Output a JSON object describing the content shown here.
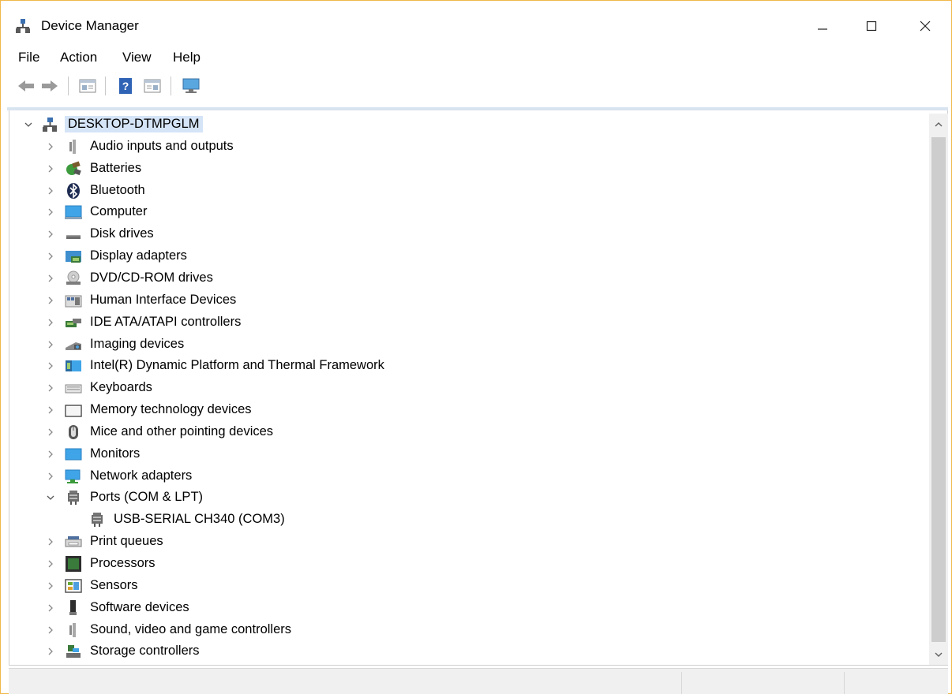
{
  "window": {
    "title": "Device Manager"
  },
  "menu": [
    "File",
    "Action",
    "View",
    "Help"
  ],
  "toolbar": [
    "back-icon",
    "forward-icon",
    "properties-icon",
    "help-icon",
    "update-driver-icon",
    "monitor-icon"
  ],
  "tree": {
    "root": "DESKTOP-DTMPGLM",
    "categories": [
      {
        "label": "Audio inputs and outputs",
        "icon": "speaker-icon"
      },
      {
        "label": "Batteries",
        "icon": "battery-icon"
      },
      {
        "label": "Bluetooth",
        "icon": "bluetooth-icon"
      },
      {
        "label": "Computer",
        "icon": "computer-icon"
      },
      {
        "label": "Disk drives",
        "icon": "disk-drive-icon"
      },
      {
        "label": "Display adapters",
        "icon": "display-adapter-icon"
      },
      {
        "label": "DVD/CD-ROM drives",
        "icon": "dvd-drive-icon"
      },
      {
        "label": "Human Interface Devices",
        "icon": "hid-icon"
      },
      {
        "label": "IDE ATA/ATAPI controllers",
        "icon": "ide-controller-icon"
      },
      {
        "label": "Imaging devices",
        "icon": "imaging-device-icon"
      },
      {
        "label": "Intel(R) Dynamic Platform and Thermal Framework",
        "icon": "intel-dptf-icon"
      },
      {
        "label": "Keyboards",
        "icon": "keyboard-icon"
      },
      {
        "label": "Memory technology devices",
        "icon": "memory-device-icon"
      },
      {
        "label": "Mice and other pointing devices",
        "icon": "mouse-icon"
      },
      {
        "label": "Monitors",
        "icon": "monitor-icon"
      },
      {
        "label": "Network adapters",
        "icon": "network-adapter-icon"
      },
      {
        "label": "Ports (COM & LPT)",
        "icon": "port-icon",
        "expanded": true,
        "children": [
          {
            "label": "USB-SERIAL CH340 (COM3)",
            "icon": "port-icon"
          }
        ]
      },
      {
        "label": "Print queues",
        "icon": "printer-icon"
      },
      {
        "label": "Processors",
        "icon": "processor-icon"
      },
      {
        "label": "Sensors",
        "icon": "sensor-icon"
      },
      {
        "label": "Software devices",
        "icon": "software-device-icon"
      },
      {
        "label": "Sound, video and game controllers",
        "icon": "speaker-icon"
      },
      {
        "label": "Storage controllers",
        "icon": "storage-controller-icon"
      }
    ]
  }
}
